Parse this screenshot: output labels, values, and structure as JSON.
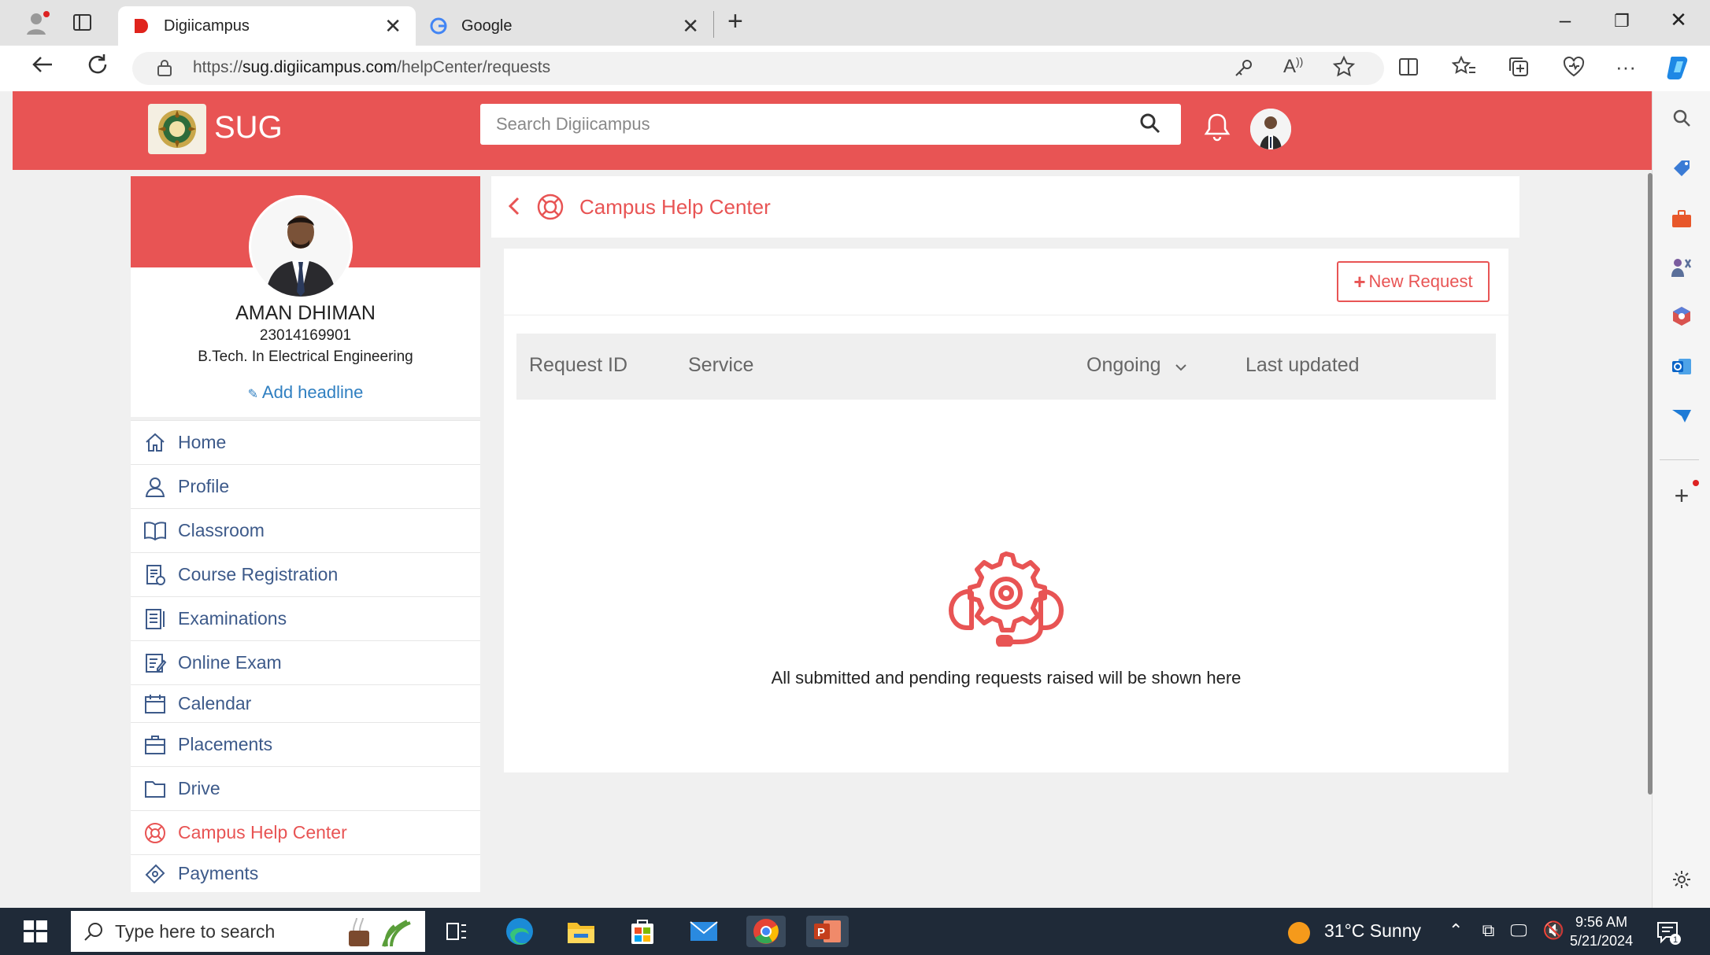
{
  "browser": {
    "tabs": [
      {
        "title": "Digiicampus",
        "active": true
      },
      {
        "title": "Google",
        "active": false
      }
    ],
    "url_prefix": "https://",
    "url_host": "sug.digiicampus.com",
    "url_path": "/helpCenter/requests"
  },
  "header": {
    "brand": "SUG",
    "search_placeholder": "Search Digiicampus",
    "accent": "#e85454"
  },
  "profile": {
    "name": "AMAN DHIMAN",
    "id": "23014169901",
    "department": "B.Tech. In Electrical Engineering",
    "headline_link": "Add headline"
  },
  "nav": {
    "items": [
      {
        "label": "Home",
        "icon": "home-icon"
      },
      {
        "label": "Profile",
        "icon": "user-icon"
      },
      {
        "label": "Classroom",
        "icon": "book-icon"
      },
      {
        "label": "Course Registration",
        "icon": "registration-icon"
      },
      {
        "label": "Examinations",
        "icon": "exam-icon"
      },
      {
        "label": "Online Exam",
        "icon": "online-exam-icon"
      },
      {
        "label": "Calendar",
        "icon": "calendar-icon"
      },
      {
        "label": "Placements",
        "icon": "briefcase-icon"
      },
      {
        "label": "Drive",
        "icon": "folder-icon"
      },
      {
        "label": "Campus Help Center",
        "icon": "lifebuoy-icon",
        "active": true
      },
      {
        "label": "Payments",
        "icon": "payment-icon"
      }
    ]
  },
  "main": {
    "title": "Campus Help Center",
    "new_request_label": "New Request",
    "columns": {
      "request_id": "Request ID",
      "service": "Service",
      "status_filter": "Ongoing",
      "last_updated": "Last updated"
    },
    "empty_message": "All submitted and pending requests raised will be shown here"
  },
  "taskbar": {
    "search_placeholder": "Type here to search",
    "weather": "31°C  Sunny",
    "time": "9:56 AM",
    "date": "5/21/2024"
  }
}
